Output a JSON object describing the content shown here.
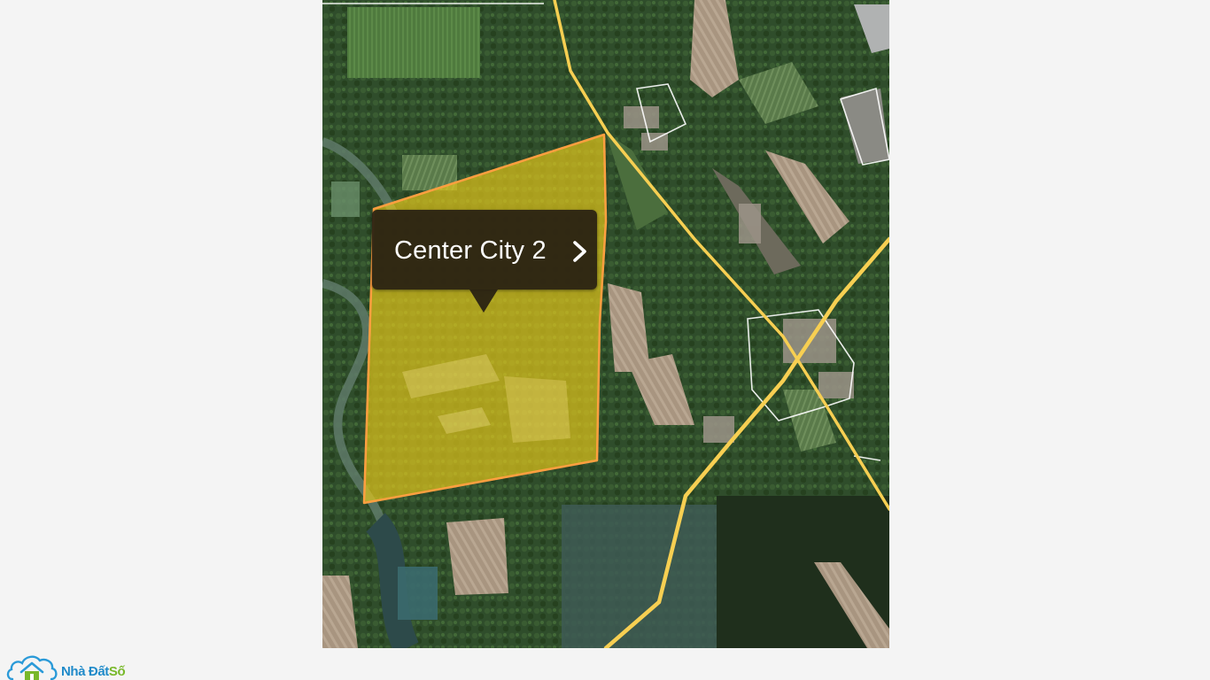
{
  "map": {
    "view": "satellite",
    "parcel": {
      "label": "Center City 2",
      "fill_color": "#e6c81a",
      "outline_color": "#ff9f40"
    },
    "callout": {
      "title": "Center City 2",
      "chevron_icon": "chevron-right-icon"
    },
    "road_color": "#f7cf52",
    "boundary_line_color": "#ffffff"
  },
  "watermark": {
    "icon": "cloud-house-icon",
    "brand_part1": "Nhà Đất",
    "brand_part2": "Số",
    "brand_color_1": "#1f8ac9",
    "brand_color_2": "#78b82a"
  }
}
